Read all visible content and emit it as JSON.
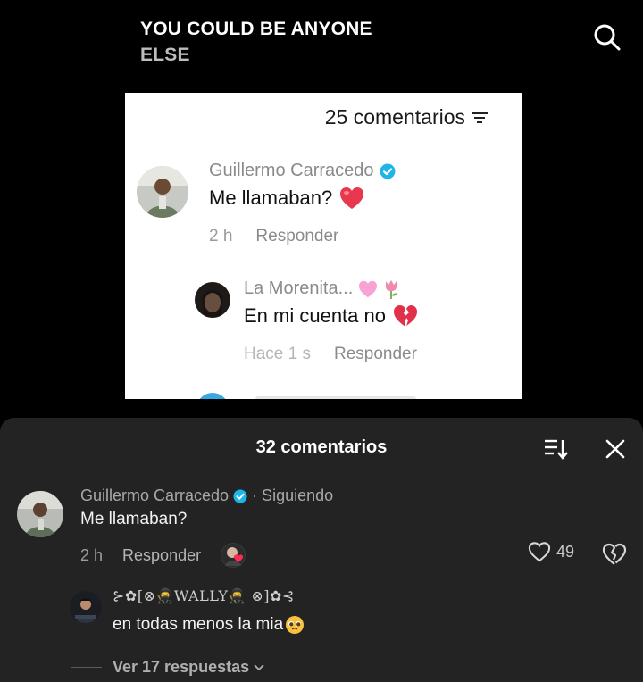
{
  "video": {
    "title_line1": "YOU COULD BE ANYONE",
    "title_line2": "ELSE"
  },
  "embedded_screenshot": {
    "comment_count": "25 comentarios",
    "comments": [
      {
        "author": "Guillermo Carracedo",
        "verified": true,
        "text": "Me llamaban?",
        "emoji": "red-heart",
        "time": "2 h",
        "reply_label": "Responder"
      },
      {
        "author": "La Morenita...",
        "author_emojis": [
          "pink-heart",
          "tulip"
        ],
        "text": "En mi cuenta no",
        "emoji": "broken-heart",
        "time": "Hace 1 s",
        "reply_label": "Responder"
      }
    ]
  },
  "comments_sheet": {
    "title": "32 comentarios",
    "icons": [
      "sort-icon",
      "close-icon"
    ],
    "comments": [
      {
        "author": "Guillermo Carracedo",
        "verified": true,
        "following": "· Siguiendo",
        "text": "Me llamaban?",
        "time": "2 h",
        "reply_label": "Responder",
        "likes": "49"
      }
    ],
    "reply": {
      "author": "⊱✿[⊗🥷WALLY🥷 ⊗]✿⊰",
      "text": "en todas menos la mia",
      "emoji": "pleading-face"
    },
    "view_replies": "Ver 17 respuestas"
  },
  "colors": {
    "sheet_bg": "#232323",
    "verified": "#20b5e8",
    "heart_red": "#fe2c55"
  }
}
